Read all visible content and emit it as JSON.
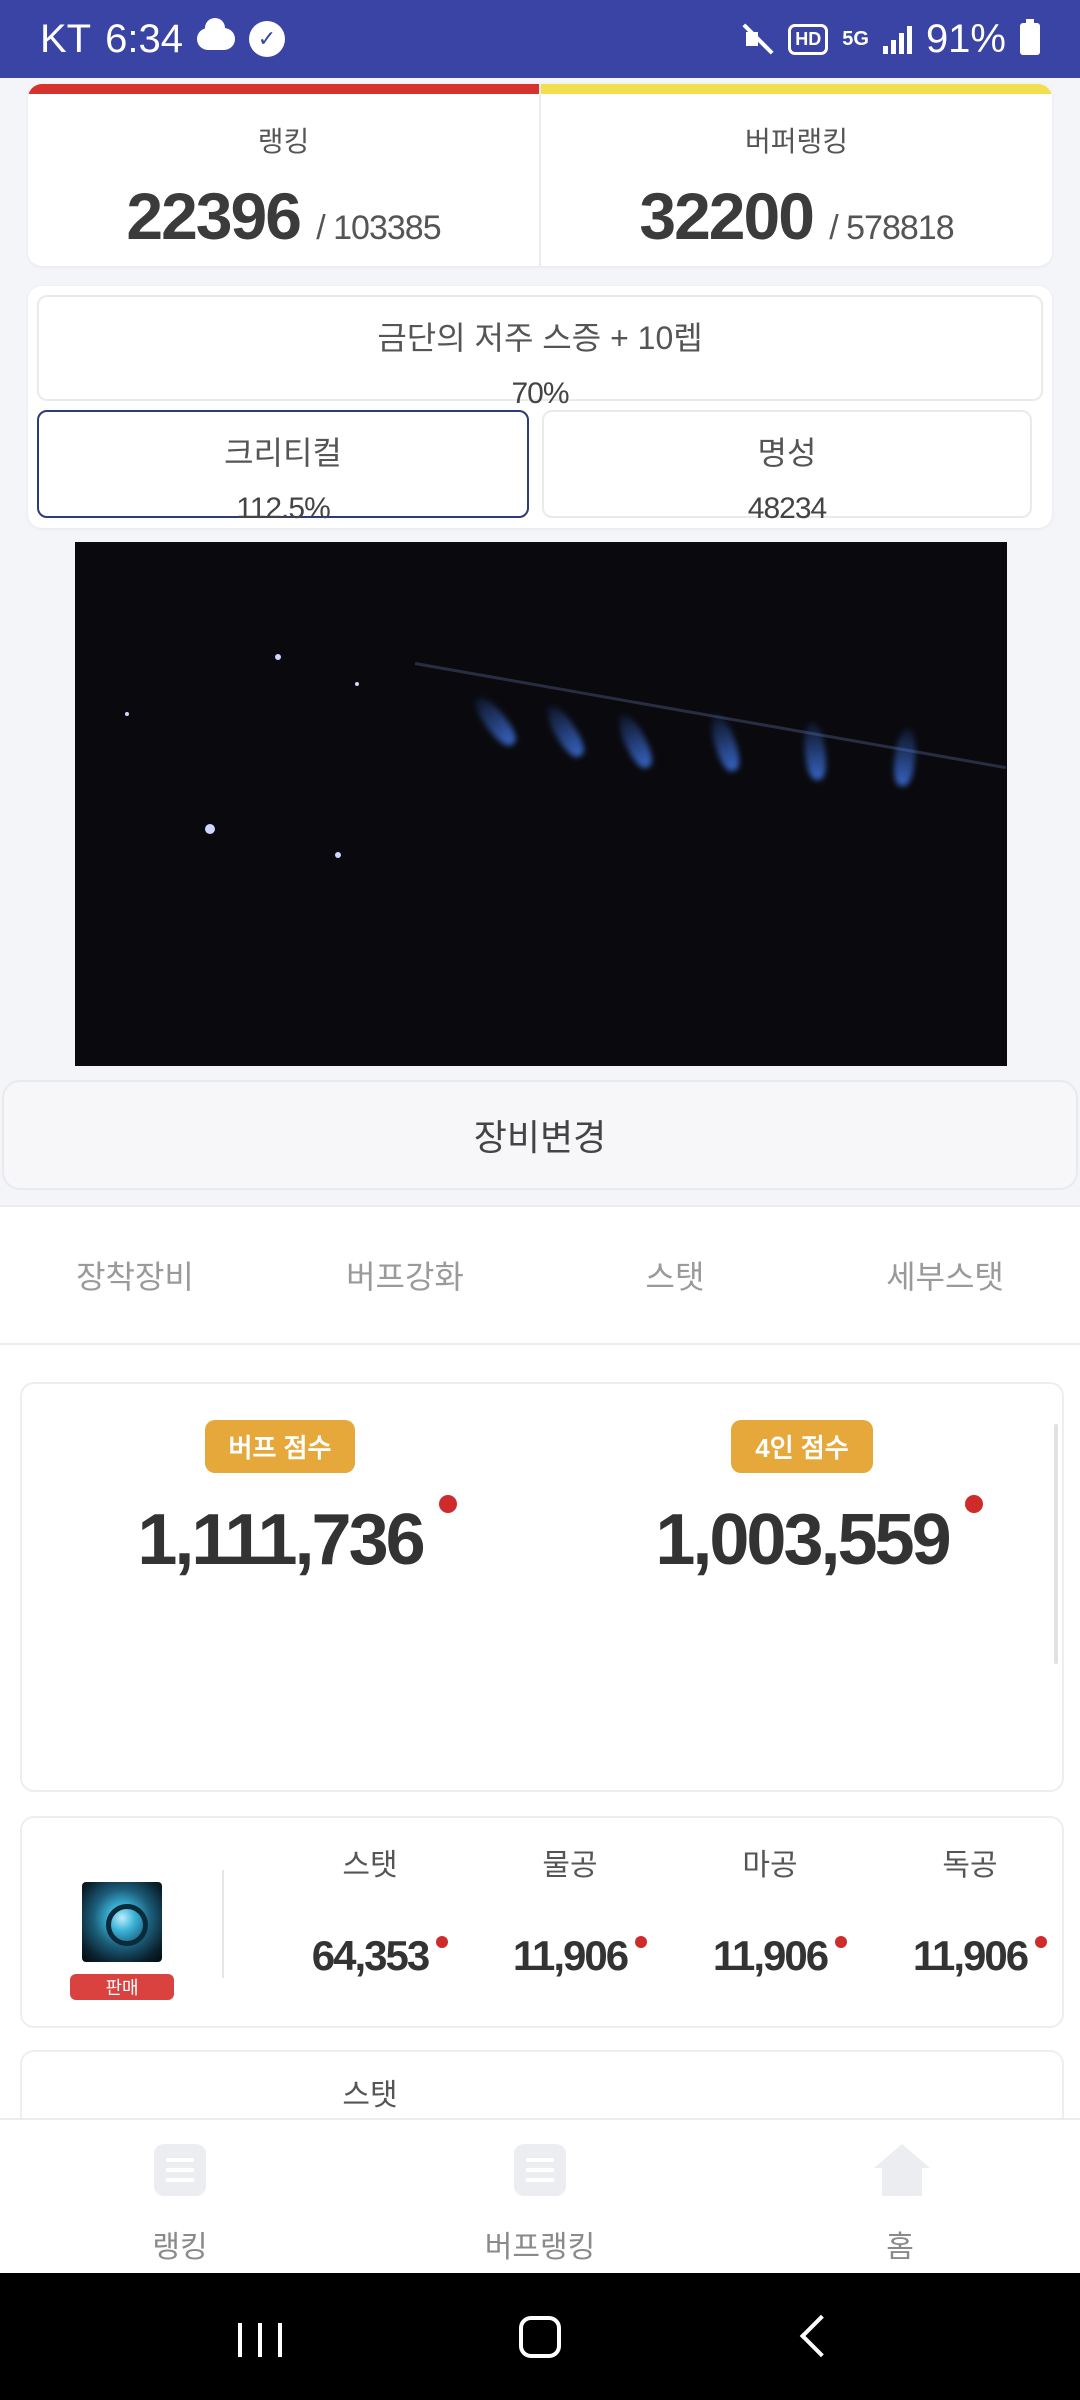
{
  "status_bar": {
    "carrier": "KT",
    "time": "6:34",
    "battery": "91%",
    "hd": "HD",
    "network": "5G"
  },
  "ranking": {
    "colors": {
      "ranking_bar": "#d6322e",
      "buffer_bar": "#f3de4e"
    },
    "left": {
      "label": "랭킹",
      "value": "22396",
      "total": "/ 103385"
    },
    "right": {
      "label": "버퍼랭킹",
      "value": "32200",
      "total": "/ 578818"
    }
  },
  "info": {
    "curse": {
      "label": "금단의 저주 스증 + 10렙",
      "value": "70%"
    },
    "critical": {
      "label": "크리티컬",
      "value": "112.5%"
    },
    "fame": {
      "label": "명성",
      "value": "48234"
    }
  },
  "equip_change_label": "장비변경",
  "tabs": [
    "장착장비",
    "버프강화",
    "스탯",
    "세부스탯"
  ],
  "scores": {
    "badge_color": "#e6a83a",
    "buff": {
      "badge": "버프 점수",
      "value": "1,111,736"
    },
    "party": {
      "badge": "4인 점수",
      "value": "1,003,559"
    }
  },
  "stat_row": {
    "sell_badge": "판매",
    "labels": [
      "스탯",
      "물공",
      "마공",
      "독공"
    ],
    "values": [
      "64,353",
      "11,906",
      "11,906",
      "11,906"
    ]
  },
  "stat_row2": {
    "label": "스탯"
  },
  "bottom_nav": [
    "랭킹",
    "버프랭킹",
    "홈"
  ]
}
